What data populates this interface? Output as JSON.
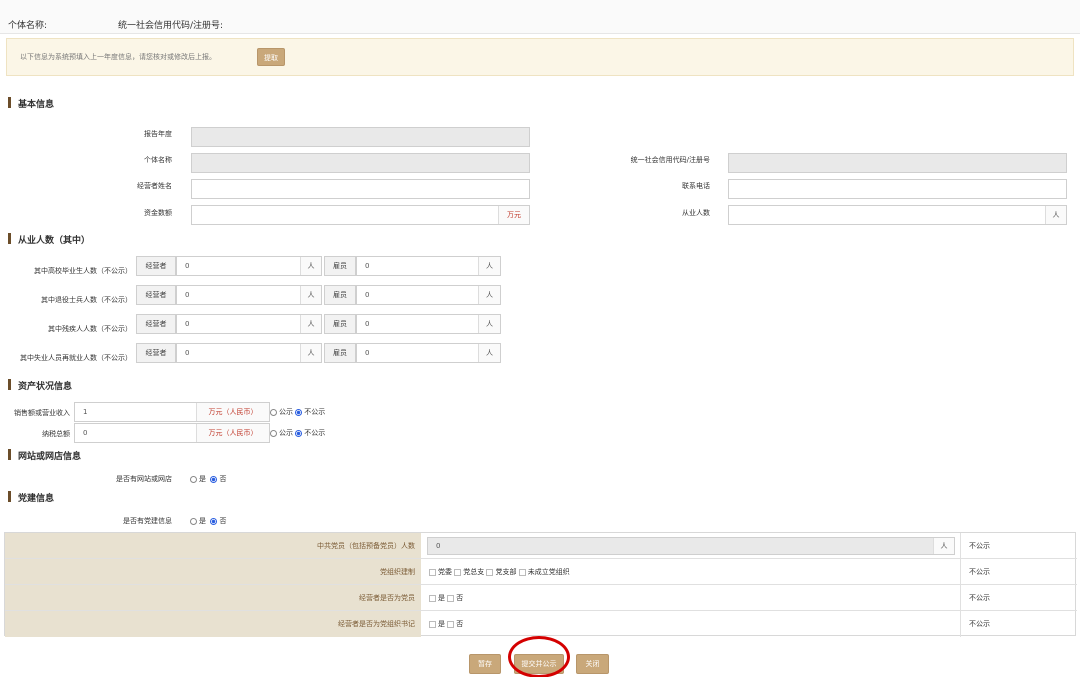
{
  "header": {
    "entity_name_label": "个体名称:",
    "credit_code_label": "统一社会信用代码/注册号:"
  },
  "notice": {
    "text": "以下信息为系统预填入上一年度信息，请您核对或修改后上报。",
    "button": "提取"
  },
  "basic": {
    "title": "基本信息",
    "report_year_label": "报告年度",
    "entity_name_label": "个体名称",
    "credit_code_label": "统一社会信用代码/注册号",
    "operator_name_label": "经营者姓名",
    "phone_label": "联系电话",
    "capital_label": "资金数额",
    "capital_unit": "万元",
    "employees_label": "从业人数",
    "employees_unit": "人"
  },
  "employees": {
    "title": "从业人数（其中）",
    "operator_label": "经营者",
    "employee_label": "雇员",
    "unit": "人",
    "rows": [
      {
        "label": "其中高校毕业生人数（不公示）",
        "operator_value": "0",
        "employee_value": "0"
      },
      {
        "label": "其中退役士兵人数（不公示）",
        "operator_value": "0",
        "employee_value": "0"
      },
      {
        "label": "其中残疾人人数（不公示）",
        "operator_value": "0",
        "employee_value": "0"
      },
      {
        "label": "其中失业人员再就业人数（不公示）",
        "operator_value": "0",
        "employee_value": "0"
      }
    ]
  },
  "assets": {
    "title": "资产状况信息",
    "rows": [
      {
        "label": "销售额或营业收入",
        "value": "1",
        "unit": "万元（人民币）",
        "public": "公示",
        "not_public": "不公示"
      },
      {
        "label": "纳税总额",
        "value": "0",
        "unit": "万元（人民币）",
        "public": "公示",
        "not_public": "不公示"
      }
    ]
  },
  "website": {
    "title": "网站或网店信息",
    "question": "是否有网站或网店",
    "yes": "是",
    "no": "否"
  },
  "party": {
    "title": "党建信息",
    "question": "是否有党建信息",
    "yes": "是",
    "no": "否",
    "members_label": "中共党员（包括预备党员）人数",
    "members_value": "0",
    "members_unit": "人",
    "org_label": "党组织建制",
    "org_options": [
      "党委",
      "党总支",
      "党支部",
      "未成立党组织"
    ],
    "operator_member_label": "经营者是否为党员",
    "operator_secretary_label": "经营者是否为党组织书记",
    "yes_opt": "是",
    "no_opt": "否",
    "not_public": "不公示"
  },
  "actions": {
    "save": "暂存",
    "submit": "提交并公示",
    "close": "关闭"
  }
}
